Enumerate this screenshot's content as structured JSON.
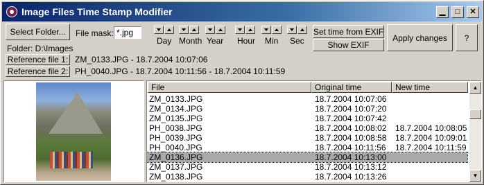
{
  "window": {
    "title": "Image Files Time Stamp Modifier",
    "controls": {
      "minimize": "▁",
      "maximize": "□",
      "close": "✕"
    }
  },
  "toolbar": {
    "select_folder_label": "Select Folder...",
    "file_mask_label": "File mask:",
    "file_mask_value": "*.jpg",
    "folder_text": "Folder: D:\\Images",
    "time_units": [
      "Day",
      "Month",
      "Year",
      "Hour",
      "Min",
      "Sec"
    ],
    "set_time_label": "Set time from EXIF",
    "show_exif_label": "Show EXIF",
    "apply_label": "Apply changes",
    "help_label": "?"
  },
  "references": [
    {
      "button": "Reference file 1:",
      "value": "ZM_0133.JPG - 18.7.2004  10:07:06"
    },
    {
      "button": "Reference file 2:",
      "value": "PH_0040.JPG - 18.7.2004  10:11:56 - 18.7.2004  10:11:59"
    }
  ],
  "file_list": {
    "columns": [
      "File",
      "Original time",
      "New time"
    ],
    "rows": [
      {
        "file": "ZM_0133.JPG",
        "original": "18.7.2004  10:07:06",
        "new": ""
      },
      {
        "file": "ZM_0134.JPG",
        "original": "18.7.2004  10:07:20",
        "new": ""
      },
      {
        "file": "ZM_0135.JPG",
        "original": "18.7.2004  10:07:42",
        "new": ""
      },
      {
        "file": "PH_0038.JPG",
        "original": "18.7.2004  10:08:02",
        "new": "18.7.2004  10:08:05"
      },
      {
        "file": "PH_0039.JPG",
        "original": "18.7.2004  10:08:58",
        "new": "18.7.2004  10:09:01"
      },
      {
        "file": "PH_0040.JPG",
        "original": "18.7.2004  10:11:56",
        "new": "18.7.2004  10:11:59"
      },
      {
        "file": "ZM_0136.JPG",
        "original": "18.7.2004  10:13:00",
        "new": ""
      },
      {
        "file": "ZM_0137.JPG",
        "original": "18.7.2004  10:13:12",
        "new": ""
      },
      {
        "file": "ZM_0138.JPG",
        "original": "18.7.2004  10:13:26",
        "new": ""
      }
    ],
    "selected_row": 6
  },
  "scrollbar_icons": {
    "up": "▲",
    "down": "▼"
  }
}
